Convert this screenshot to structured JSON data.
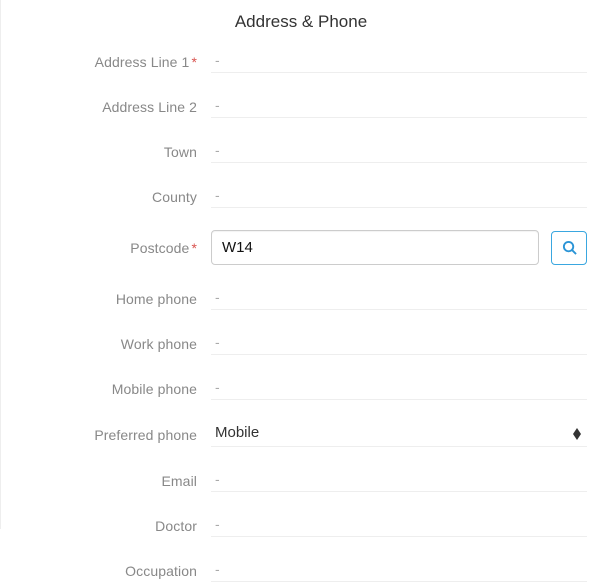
{
  "section_title": "Address & Phone",
  "fields": {
    "address1": {
      "label": "Address Line 1",
      "value": "-",
      "required": true
    },
    "address2": {
      "label": "Address Line 2",
      "value": "-",
      "required": false
    },
    "town": {
      "label": "Town",
      "value": "-",
      "required": false
    },
    "county": {
      "label": "County",
      "value": "-",
      "required": false
    },
    "postcode": {
      "label": "Postcode",
      "value": "W14",
      "required": true
    },
    "home_phone": {
      "label": "Home phone",
      "value": "-",
      "required": false
    },
    "work_phone": {
      "label": "Work phone",
      "value": "-",
      "required": false
    },
    "mobile_phone": {
      "label": "Mobile phone",
      "value": "-",
      "required": false
    },
    "preferred_phone": {
      "label": "Preferred phone",
      "value": "Mobile",
      "required": false
    },
    "email": {
      "label": "Email",
      "value": "-",
      "required": false
    },
    "doctor": {
      "label": "Doctor",
      "value": "-",
      "required": false
    },
    "occupation": {
      "label": "Occupation",
      "value": "-",
      "required": false
    }
  },
  "required_marker": "*"
}
